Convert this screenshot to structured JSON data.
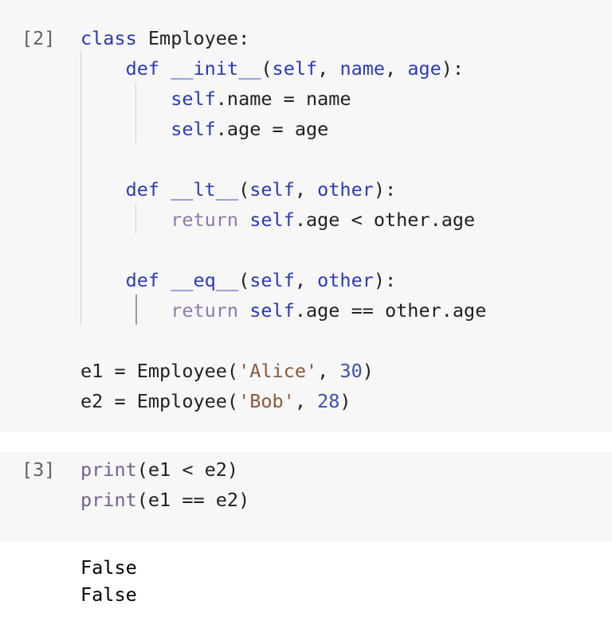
{
  "cells": [
    {
      "prompt": "[2]",
      "lines": [
        [
          {
            "t": "class",
            "c": "kw"
          },
          {
            "t": " Employee:"
          }
        ],
        [
          {
            "t": "    "
          },
          {
            "t": "def",
            "c": "kw"
          },
          {
            "t": " "
          },
          {
            "t": "__init__",
            "c": "fn"
          },
          {
            "t": "("
          },
          {
            "t": "self",
            "c": "kw"
          },
          {
            "t": ", "
          },
          {
            "t": "name",
            "c": "param"
          },
          {
            "t": ", "
          },
          {
            "t": "age",
            "c": "param"
          },
          {
            "t": "):"
          }
        ],
        [
          {
            "t": "        "
          },
          {
            "t": "self",
            "c": "kw"
          },
          {
            "t": ".name = name"
          }
        ],
        [
          {
            "t": "        "
          },
          {
            "t": "self",
            "c": "kw"
          },
          {
            "t": ".age = age"
          }
        ],
        [
          {
            "t": ""
          }
        ],
        [
          {
            "t": "    "
          },
          {
            "t": "def",
            "c": "kw"
          },
          {
            "t": " "
          },
          {
            "t": "__lt__",
            "c": "fn"
          },
          {
            "t": "("
          },
          {
            "t": "self",
            "c": "kw"
          },
          {
            "t": ", "
          },
          {
            "t": "other",
            "c": "param"
          },
          {
            "t": "):"
          }
        ],
        [
          {
            "t": "        "
          },
          {
            "t": "return",
            "c": "ret"
          },
          {
            "t": " "
          },
          {
            "t": "self",
            "c": "kw"
          },
          {
            "t": ".age < other.age"
          }
        ],
        [
          {
            "t": ""
          }
        ],
        [
          {
            "t": "    "
          },
          {
            "t": "def",
            "c": "kw"
          },
          {
            "t": " "
          },
          {
            "t": "__eq__",
            "c": "fn"
          },
          {
            "t": "("
          },
          {
            "t": "self",
            "c": "kw"
          },
          {
            "t": ", "
          },
          {
            "t": "other",
            "c": "param"
          },
          {
            "t": "):"
          }
        ],
        [
          {
            "t": "        "
          },
          {
            "t": "return",
            "c": "ret"
          },
          {
            "t": " "
          },
          {
            "t": "self",
            "c": "kw"
          },
          {
            "t": ".age == other.age"
          }
        ],
        [
          {
            "t": ""
          }
        ],
        [
          {
            "t": "e1 = Employee("
          },
          {
            "t": "'Alice'",
            "c": "str"
          },
          {
            "t": ", "
          },
          {
            "t": "30",
            "c": "num"
          },
          {
            "t": ")"
          }
        ],
        [
          {
            "t": "e2 = Employee("
          },
          {
            "t": "'Bob'",
            "c": "str"
          },
          {
            "t": ", "
          },
          {
            "t": "28",
            "c": "num"
          },
          {
            "t": ")"
          }
        ]
      ]
    },
    {
      "prompt": "[3]",
      "lines": [
        [
          {
            "t": "print",
            "c": "bi"
          },
          {
            "t": "(e1 < e2)"
          }
        ],
        [
          {
            "t": "print",
            "c": "bi"
          },
          {
            "t": "(e1 == e2)"
          }
        ]
      ]
    }
  ],
  "output": [
    "False",
    "False"
  ]
}
